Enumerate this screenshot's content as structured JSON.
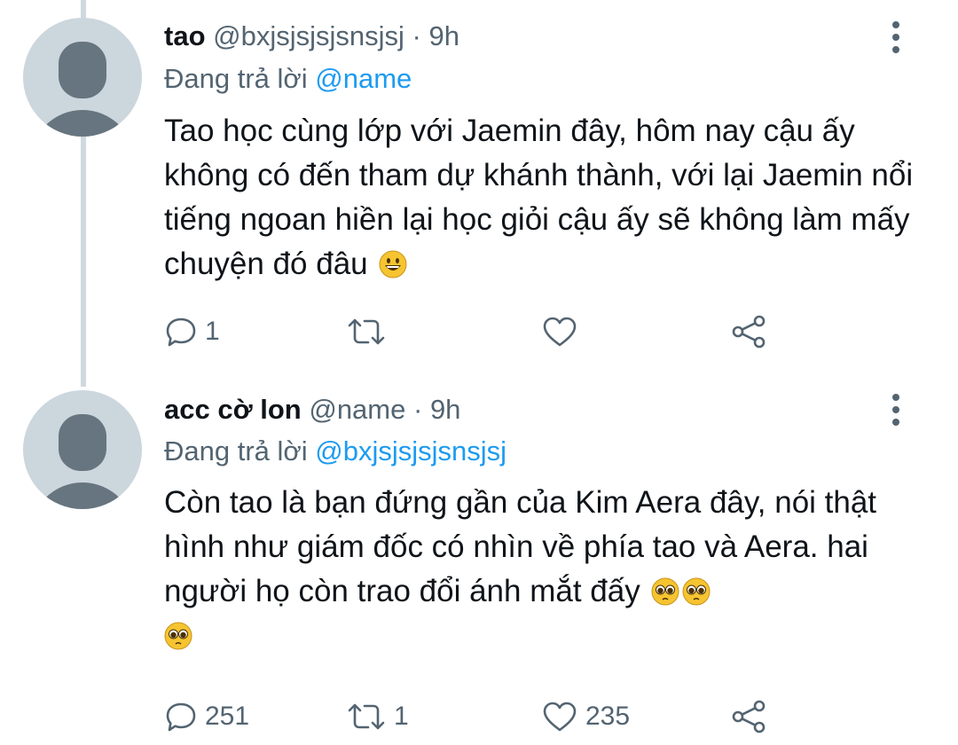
{
  "tweets": [
    {
      "name": "tao",
      "handle": "@bxjsjsjsjsnsjsj",
      "separator": "·",
      "time": "9h",
      "reply_prefix": "Đang trả lời",
      "reply_to": "@name",
      "text": "Tao học cùng lớp với Jaemin đây, hôm nay cậu ấy không có đến tham dự khánh thành, với lại Jaemin nổi tiếng ngoan hiền lại học giỏi cậu ấy sẽ không làm mấy chuyện đó đâu",
      "emojis": [
        "grinning-face-emoji"
      ],
      "stats": {
        "replies": "1",
        "retweets": "",
        "likes": ""
      }
    },
    {
      "name": "acc cờ lon",
      "handle": "@name",
      "separator": "·",
      "time": "9h",
      "reply_prefix": "Đang trả lời",
      "reply_to": "@bxjsjsjsjsnsjsj",
      "text": "Còn tao là bạn đứng gần của Kim Aera đây, nói thật hình như giám đốc có nhìn về phía tao và Aera. hai người họ còn trao đổi ánh mắt đấy",
      "emojis": [
        "pleading-face-emoji",
        "pleading-face-emoji",
        "pleading-face-emoji"
      ],
      "stats": {
        "replies": "251",
        "retweets": "1",
        "likes": "235"
      }
    }
  ],
  "colors": {
    "text": "#0f1419",
    "secondary": "#536471",
    "accent": "#1d9bf0",
    "avatar_bg": "#ccd6dd",
    "avatar_fg": "#66757f",
    "thread_line": "#cfd9de"
  },
  "icons": {
    "reply": "speech-bubble-icon",
    "retweet": "retweet-arrows-icon",
    "like": "heart-icon",
    "share": "share-nodes-icon",
    "more": "vertical-ellipsis-icon"
  }
}
